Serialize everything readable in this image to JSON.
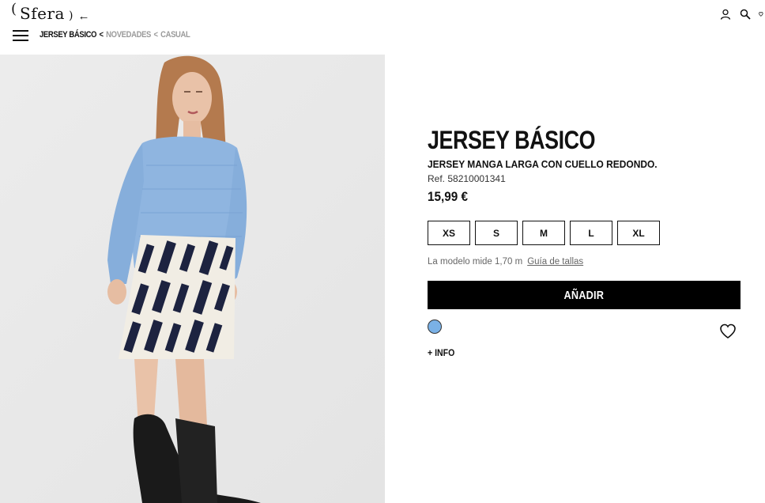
{
  "brand": {
    "name": "Sfera",
    "back_arrow": "←"
  },
  "header": {
    "icons": [
      "user-icon",
      "search-icon",
      "bag-icon"
    ]
  },
  "breadcrumb": {
    "current": "JERSEY BÁSICO",
    "sep1": "<",
    "link1": "NOVEDADES",
    "sep2": "<",
    "link2": "CASUAL"
  },
  "product": {
    "title": "JERSEY BÁSICO",
    "subtitle": "JERSEY MANGA LARGA CON CUELLO REDONDO.",
    "ref": "Ref. 58210001341",
    "price": "15,99 €",
    "sizes": [
      "XS",
      "S",
      "M",
      "L",
      "XL"
    ],
    "model_note": "La modelo mide 1,70 m",
    "size_guide": "Guía de tallas",
    "add_label": "AÑADIR",
    "color": "#7ab1e6",
    "more_info": "+ INFO"
  }
}
